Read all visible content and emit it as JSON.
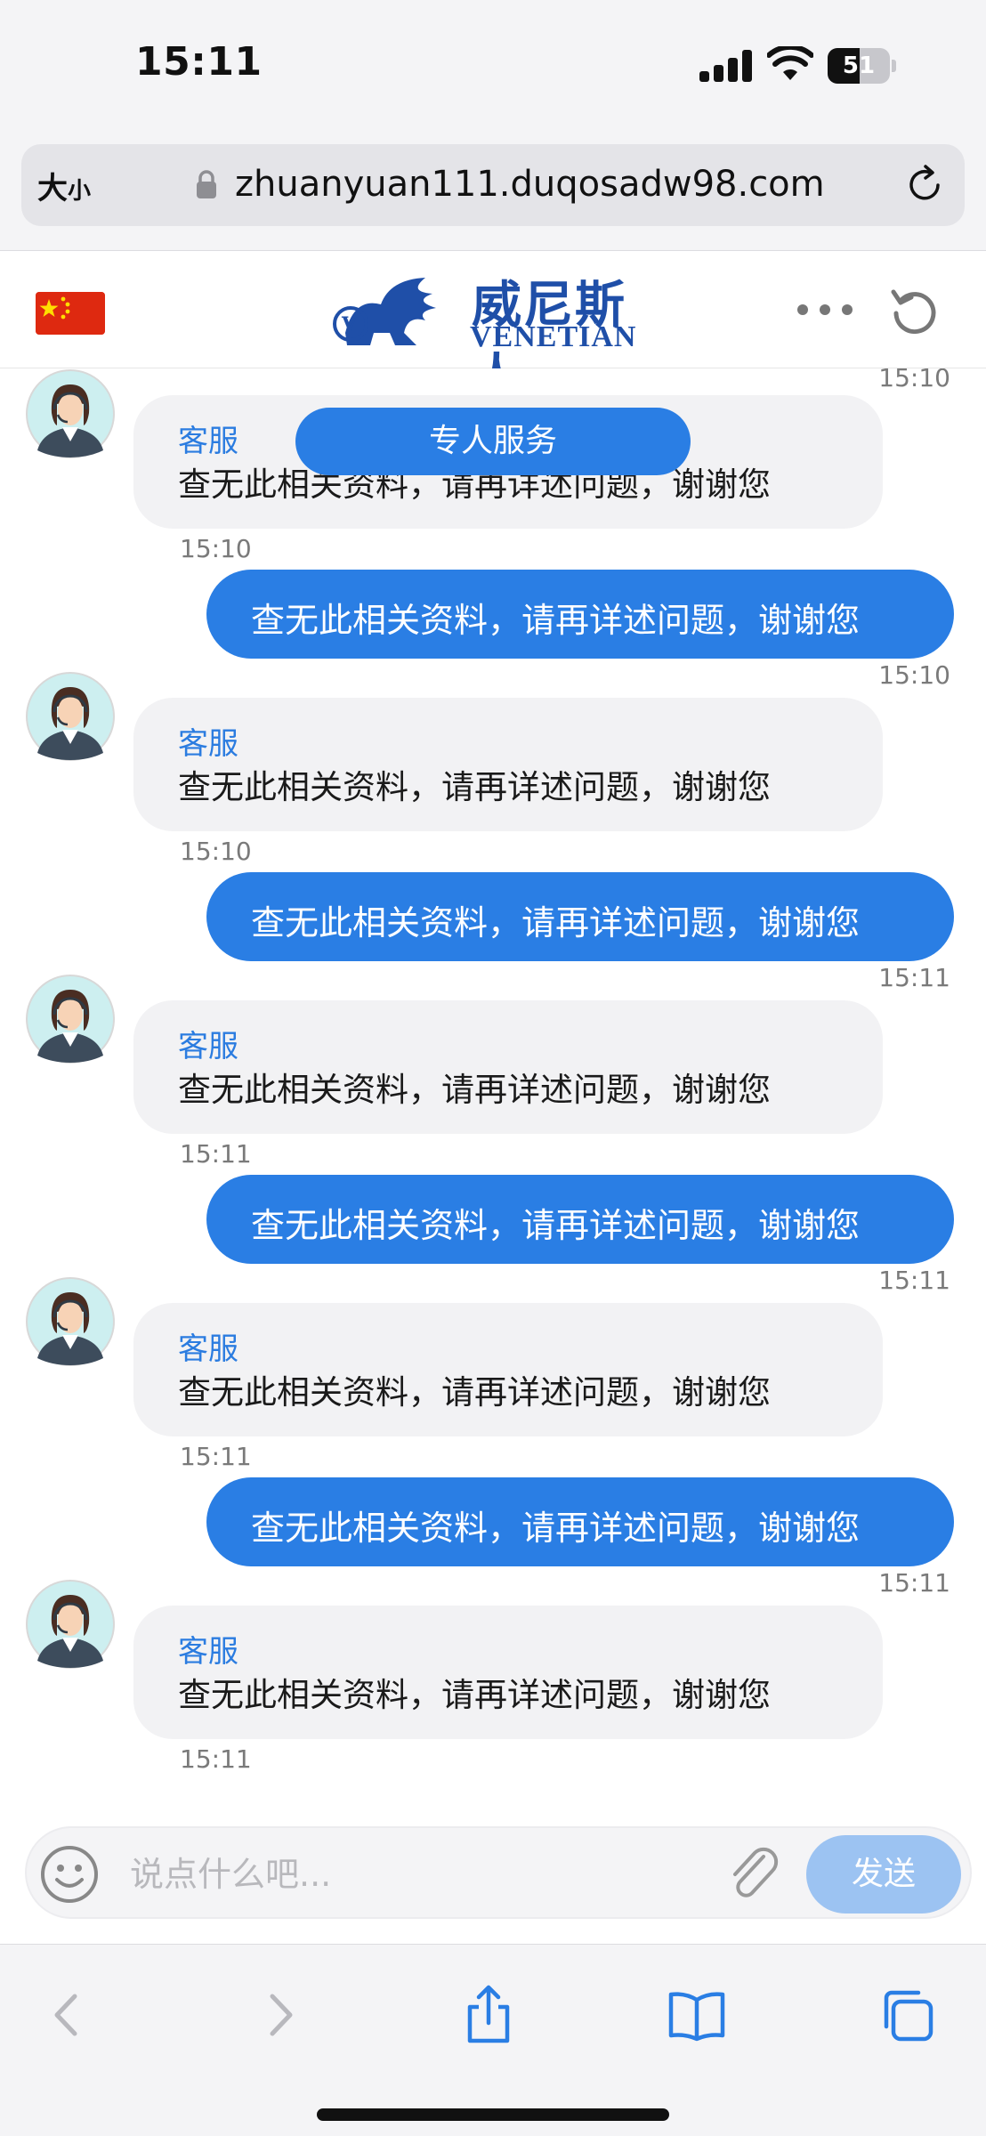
{
  "status_bar": {
    "time": "15:11",
    "battery": "51",
    "battery_level_percent": 51
  },
  "address_bar": {
    "text_size_label": "大",
    "text_size_small": "小",
    "url": "zhuanyuan111.duqosadw98.com"
  },
  "site_header": {
    "brand_cn": "威尼斯人",
    "brand_en": "VENETIAN"
  },
  "chat": {
    "service_pill": "专人服务",
    "top_timestamp": "15:10",
    "sender_name": "客服",
    "message_text": "查无此相关资料，请再详述问题，谢谢您",
    "messages": [
      {
        "direction": "in",
        "sender": "客服",
        "text": "查无此相关资料，请再详述问题，谢谢您",
        "time": "15:10"
      },
      {
        "direction": "out",
        "text": "查无此相关资料，请再详述问题，谢谢您",
        "time": "15:10"
      },
      {
        "direction": "in",
        "sender": "客服",
        "text": "查无此相关资料，请再详述问题，谢谢您",
        "time": "15:10"
      },
      {
        "direction": "out",
        "text": "查无此相关资料，请再详述问题，谢谢您",
        "time": "15:11"
      },
      {
        "direction": "in",
        "sender": "客服",
        "text": "查无此相关资料，请再详述问题，谢谢您",
        "time": "15:11"
      },
      {
        "direction": "out",
        "text": "查无此相关资料，请再详述问题，谢谢您",
        "time": "15:11"
      },
      {
        "direction": "in",
        "sender": "客服",
        "text": "查无此相关资料，请再详述问题，谢谢您",
        "time": "15:11"
      },
      {
        "direction": "out",
        "text": "查无此相关资料，请再详述问题，谢谢您",
        "time": "15:11"
      },
      {
        "direction": "in",
        "sender": "客服",
        "text": "查无此相关资料，请再详述问题，谢谢您",
        "time": "15:11"
      }
    ]
  },
  "composer": {
    "placeholder": "说点什么吧...",
    "send_label": "发送"
  },
  "colors": {
    "accent": "#2a7ee4",
    "send_disabled": "#9cc3f2",
    "incoming_bubble": "#f2f2f4",
    "sender_name": "#2b7ce0"
  },
  "icons": [
    "signal-icon",
    "wifi-icon",
    "battery-icon",
    "lock-icon",
    "reload-icon",
    "china-flag-icon",
    "venetian-logo",
    "more-icon",
    "refresh-icon",
    "agent-avatar",
    "emoji-icon",
    "attach-icon",
    "back-icon",
    "forward-icon",
    "share-icon",
    "bookmarks-icon",
    "tabs-icon"
  ]
}
